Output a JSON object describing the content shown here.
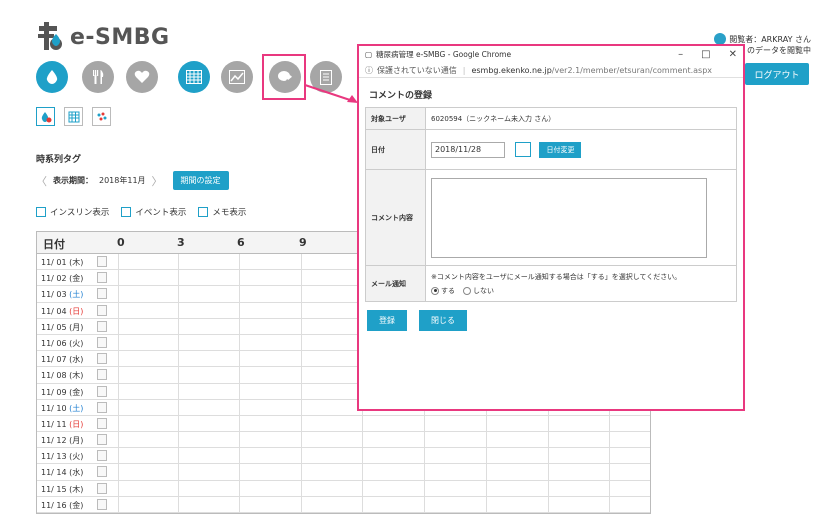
{
  "app": {
    "logo_text": "e-SMBG"
  },
  "header": {
    "viewer": "閲覧者：ARKRAY さん",
    "viewer_sub": "のデータを閲覧中",
    "logout_label": "ログアウト"
  },
  "nav": {
    "circles": [
      "drop-icon",
      "meal-icon",
      "heart-icon",
      "grid-icon",
      "chart-icon",
      "comment-icon",
      "document-icon"
    ]
  },
  "section": {
    "title": "時系列タグ",
    "period_label": "表示期間：",
    "period_value": "2018年11月",
    "period_button": "期間の設定"
  },
  "checks": [
    {
      "label": "インスリン表示"
    },
    {
      "label": "イベント表示"
    },
    {
      "label": "メモ表示"
    }
  ],
  "table": {
    "date_header": "日付",
    "hours": [
      "0",
      "3",
      "6",
      "9"
    ],
    "rows": [
      {
        "date": "11/ 01 ",
        "wd": "(木)",
        "type": ""
      },
      {
        "date": "11/ 02 ",
        "wd": "(金)",
        "type": ""
      },
      {
        "date": "11/ 03 ",
        "wd": "(土)",
        "type": "sat"
      },
      {
        "date": "11/ 04 ",
        "wd": "(日)",
        "type": "sun"
      },
      {
        "date": "11/ 05 ",
        "wd": "(月)",
        "type": ""
      },
      {
        "date": "11/ 06 ",
        "wd": "(火)",
        "type": ""
      },
      {
        "date": "11/ 07 ",
        "wd": "(水)",
        "type": ""
      },
      {
        "date": "11/ 08 ",
        "wd": "(木)",
        "type": ""
      },
      {
        "date": "11/ 09 ",
        "wd": "(金)",
        "type": ""
      },
      {
        "date": "11/ 10 ",
        "wd": "(土)",
        "type": "sat"
      },
      {
        "date": "11/ 11 ",
        "wd": "(日)",
        "type": "sun"
      },
      {
        "date": "11/ 12 ",
        "wd": "(月)",
        "type": ""
      },
      {
        "date": "11/ 13 ",
        "wd": "(火)",
        "type": ""
      },
      {
        "date": "11/ 14 ",
        "wd": "(水)",
        "type": ""
      },
      {
        "date": "11/ 15 ",
        "wd": "(木)",
        "type": ""
      },
      {
        "date": "11/ 16 ",
        "wd": "(金)",
        "type": ""
      }
    ]
  },
  "popup": {
    "title": "糖尿病管理 e-SMBG - Google Chrome",
    "security": "保護されていない通信",
    "url_host": "esmbg.ekenko.ne.jp",
    "url_path": "/ver2.1/member/etsuran/comment.aspx",
    "heading": "コメントの登録",
    "fields": {
      "user_label": "対象ユーザ",
      "user_value": "6020594（ニックネーム未入力 さん）",
      "date_label": "日付",
      "date_value": "2018/11/28",
      "date_change": "日付変更",
      "comment_label": "コメント内容",
      "mail_label": "メール通知",
      "mail_note": "※コメント内容をユーザにメール通知する場合は「する」を選択してください。",
      "mail_yes": "する",
      "mail_no": "しない"
    },
    "register_label": "登録",
    "close_label": "閉じる"
  },
  "colors": {
    "accent": "#1fa0c8",
    "highlight": "#e9387f",
    "inactive": "#a6a6a6"
  }
}
